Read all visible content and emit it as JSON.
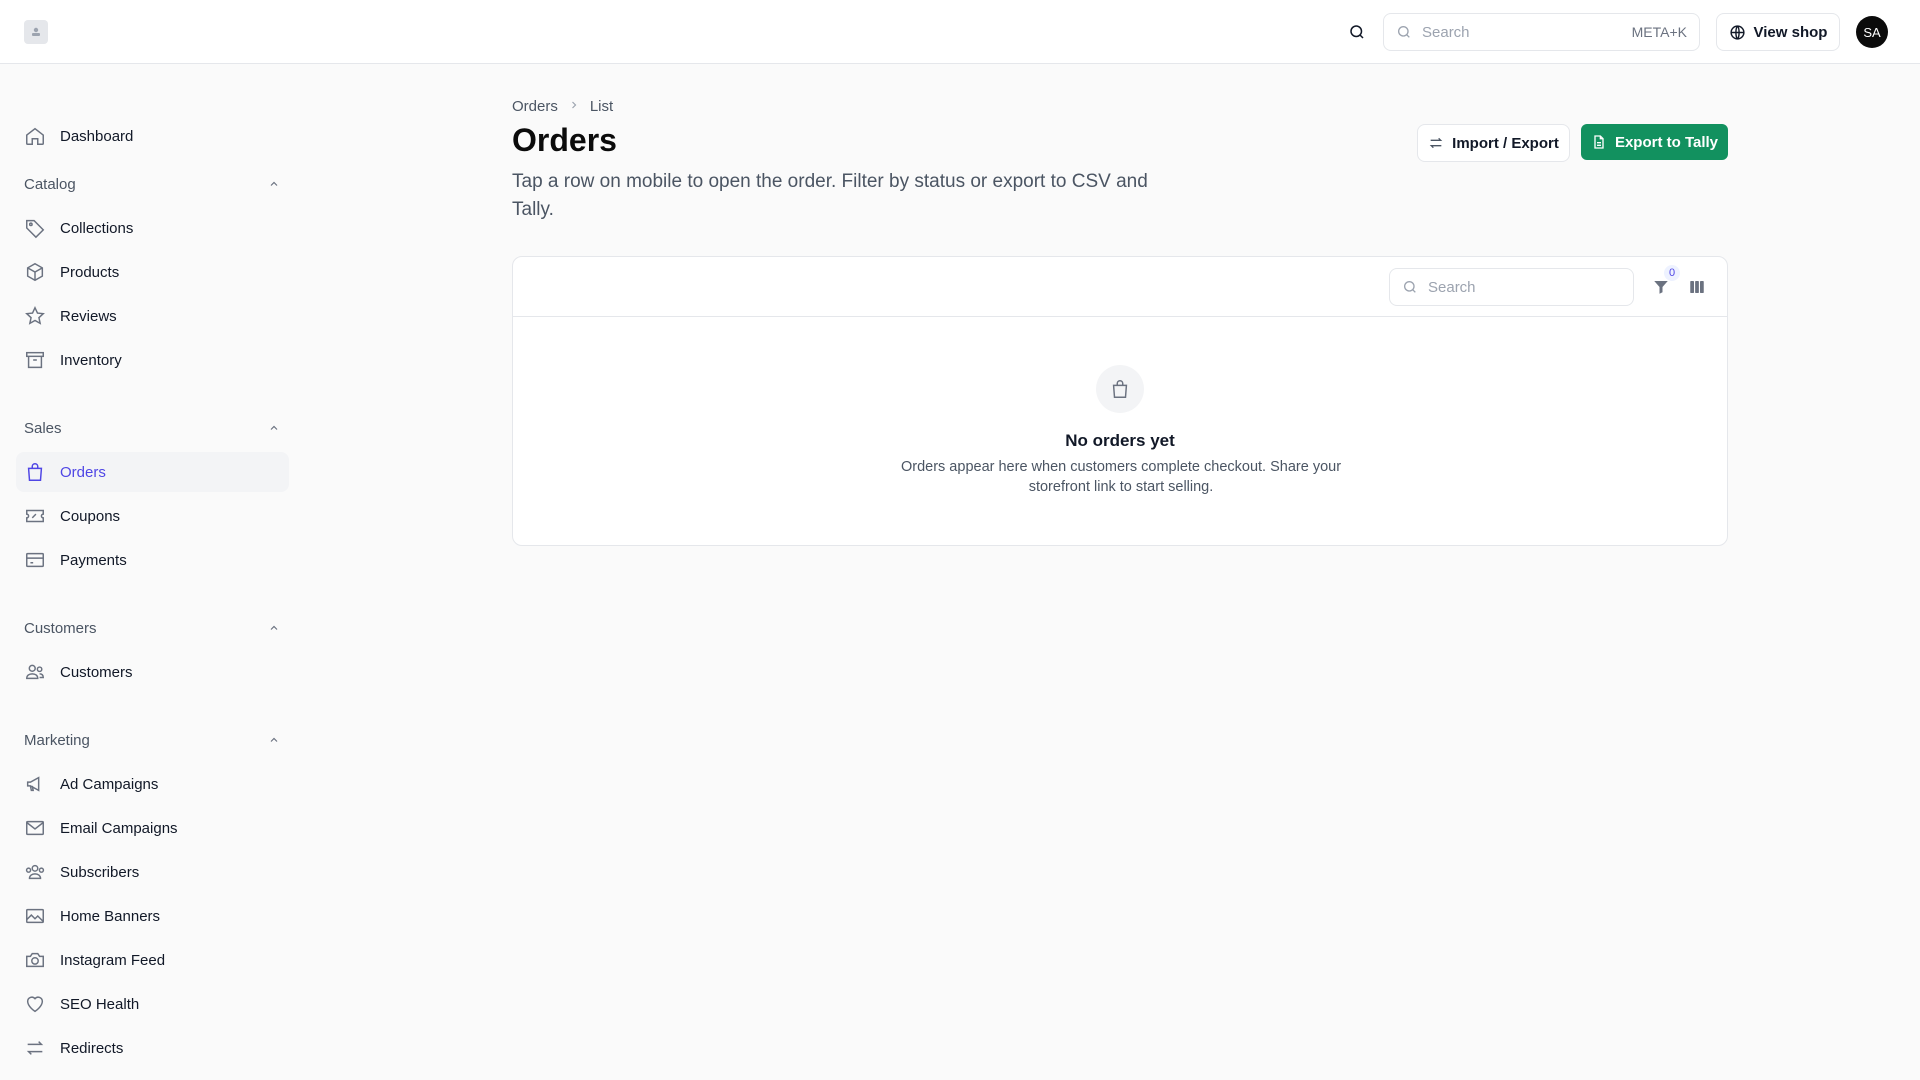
{
  "header": {
    "search": {
      "placeholder": "Search",
      "shortcut": "META+K"
    },
    "view_shop_label": "View shop",
    "avatar_initials": "SA"
  },
  "sidebar": {
    "dashboard": "Dashboard",
    "sections": {
      "catalog": {
        "title": "Catalog",
        "items": [
          "Collections",
          "Products",
          "Reviews",
          "Inventory"
        ]
      },
      "sales": {
        "title": "Sales",
        "items": [
          "Orders",
          "Coupons",
          "Payments"
        ]
      },
      "customers": {
        "title": "Customers",
        "items": [
          "Customers"
        ]
      },
      "marketing": {
        "title": "Marketing",
        "items": [
          "Ad Campaigns",
          "Email Campaigns",
          "Subscribers",
          "Home Banners",
          "Instagram Feed",
          "SEO Health",
          "Redirects"
        ]
      }
    },
    "active_item": "Orders"
  },
  "main": {
    "breadcrumb": [
      "Orders",
      "List"
    ],
    "title": "Orders",
    "description": "Tap a row on mobile to open the order. Filter by status or export to CSV and Tally.",
    "import_export_label": "Import / Export",
    "export_tally_label": "Export to Tally",
    "table": {
      "search_placeholder": "Search",
      "filter_count": "0",
      "empty_title": "No orders yet",
      "empty_description": "Orders appear here when customers complete checkout. Share your storefront link to start selling."
    }
  },
  "colors": {
    "accent": "#4f46e5",
    "primary_button": "#12915f"
  }
}
